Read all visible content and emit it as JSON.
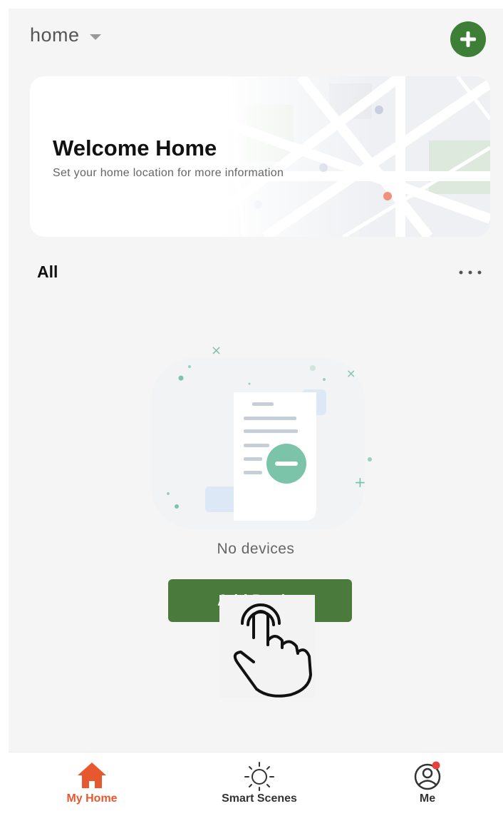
{
  "header": {
    "home_name": "home",
    "add_icon": "plus-icon"
  },
  "welcome": {
    "title": "Welcome Home",
    "subtitle": "Set your home location for more information"
  },
  "devices": {
    "section_title": "All",
    "empty_message": "No devices",
    "add_button_label": "Add Device"
  },
  "tabbar": {
    "tabs": [
      {
        "label": "My Home",
        "icon": "home-icon",
        "active": true
      },
      {
        "label": "Smart Scenes",
        "icon": "sun-icon",
        "active": false
      },
      {
        "label": "Me",
        "icon": "user-icon",
        "active": false,
        "notification_dot": true
      }
    ]
  },
  "colors": {
    "brand_green": "#3e7f37",
    "active_tab": "#e8582f",
    "notification": "#e8413b"
  }
}
